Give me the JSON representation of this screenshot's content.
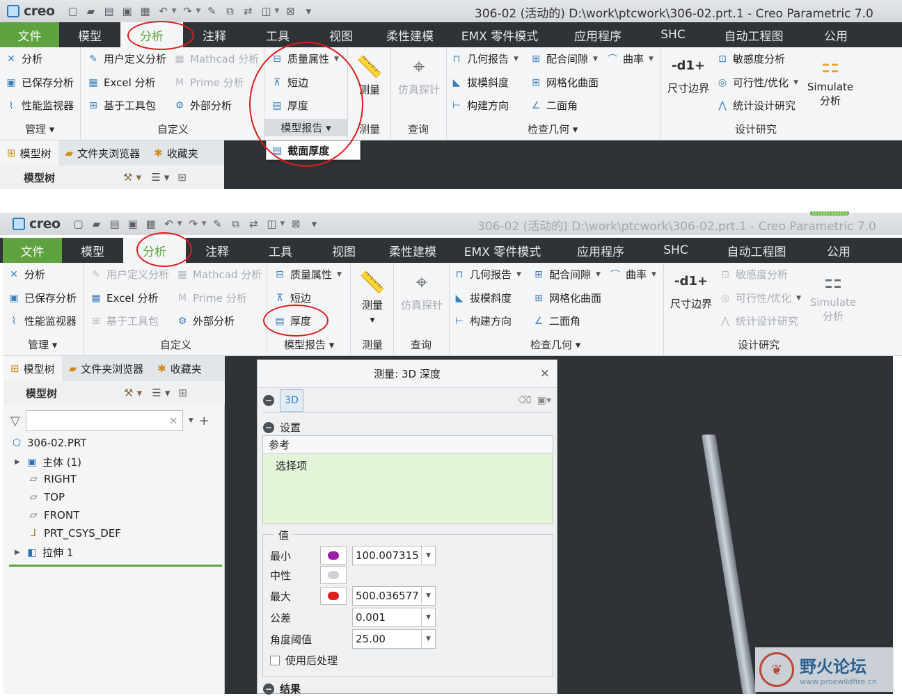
{
  "window": {
    "app_logo": "creo",
    "title": "306-02 (活动的) D:\\work\\ptcwork\\306-02.prt.1 - Creo Parametric 7.0"
  },
  "tabs": [
    "文件",
    "模型",
    "分析",
    "注释",
    "工具",
    "视图",
    "柔性建模",
    "EMX 零件模式",
    "应用程序",
    "SHC",
    "自动工程图",
    "公用"
  ],
  "ribbon": {
    "manage": {
      "items": [
        "分析",
        "已保存分析",
        "性能监视器"
      ],
      "label": "管理"
    },
    "custom": {
      "items": [
        "用户定义分析",
        "Mathcad 分析",
        "Excel 分析",
        "Prime 分析",
        "基于工具包",
        "外部分析"
      ],
      "label": "自定义"
    },
    "model_report": {
      "items": [
        "质量属性",
        "短边",
        "厚度"
      ],
      "label": "模型报告"
    },
    "measure": {
      "button": "测量",
      "label": "测量"
    },
    "query": {
      "button": "仿真探针",
      "label": "查询"
    },
    "inspect": {
      "items": [
        "几何报告",
        "配合间隙",
        "曲率",
        "拔模斜度",
        "网格化曲面",
        "构建方向",
        "二面角"
      ],
      "label": "检查几何"
    },
    "design": {
      "items": [
        "敏感度分析",
        "可行性/优化",
        "统计设计研究"
      ],
      "dim_button": "尺寸边界",
      "sim_button_1": "Simulate",
      "sim_button_2": "分析",
      "label": "设计研究"
    }
  },
  "popup_menu": {
    "item": "截面厚度"
  },
  "panel_tabs": [
    "模型树",
    "文件夹浏览器",
    "收藏夹"
  ],
  "tree_header": "模型树",
  "tree": {
    "items": [
      {
        "label": "306-02.PRT",
        "icon": "part-icon"
      },
      {
        "label": "主体 (1)",
        "icon": "body-icon"
      },
      {
        "label": "RIGHT",
        "icon": "datum-plane-icon"
      },
      {
        "label": "TOP",
        "icon": "datum-plane-icon"
      },
      {
        "label": "FRONT",
        "icon": "datum-plane-icon"
      },
      {
        "label": "PRT_CSYS_DEF",
        "icon": "csys-icon"
      },
      {
        "label": "拉伸 1",
        "icon": "extrude-icon"
      }
    ]
  },
  "dialog": {
    "title": "测量: 3D 深度",
    "settings_header": "设置",
    "ref_header": "参考",
    "ref_select": "选择项",
    "values_header": "值",
    "rows": [
      {
        "label": "最小",
        "value": "100.007315",
        "color": "#9c1fa8"
      },
      {
        "label": "中性",
        "value": "",
        "color": "#cfd2d6"
      },
      {
        "label": "最大",
        "value": "500.036577",
        "color": "#e0201f"
      },
      {
        "label": "公差",
        "value": "0.001",
        "color": ""
      },
      {
        "label": "角度阈值",
        "value": "25.00",
        "color": ""
      }
    ],
    "postprocess": "使用后处理",
    "results_header": "结果"
  },
  "watermark": {
    "title": "野火论坛",
    "url": "www.proewildfire.cn"
  }
}
